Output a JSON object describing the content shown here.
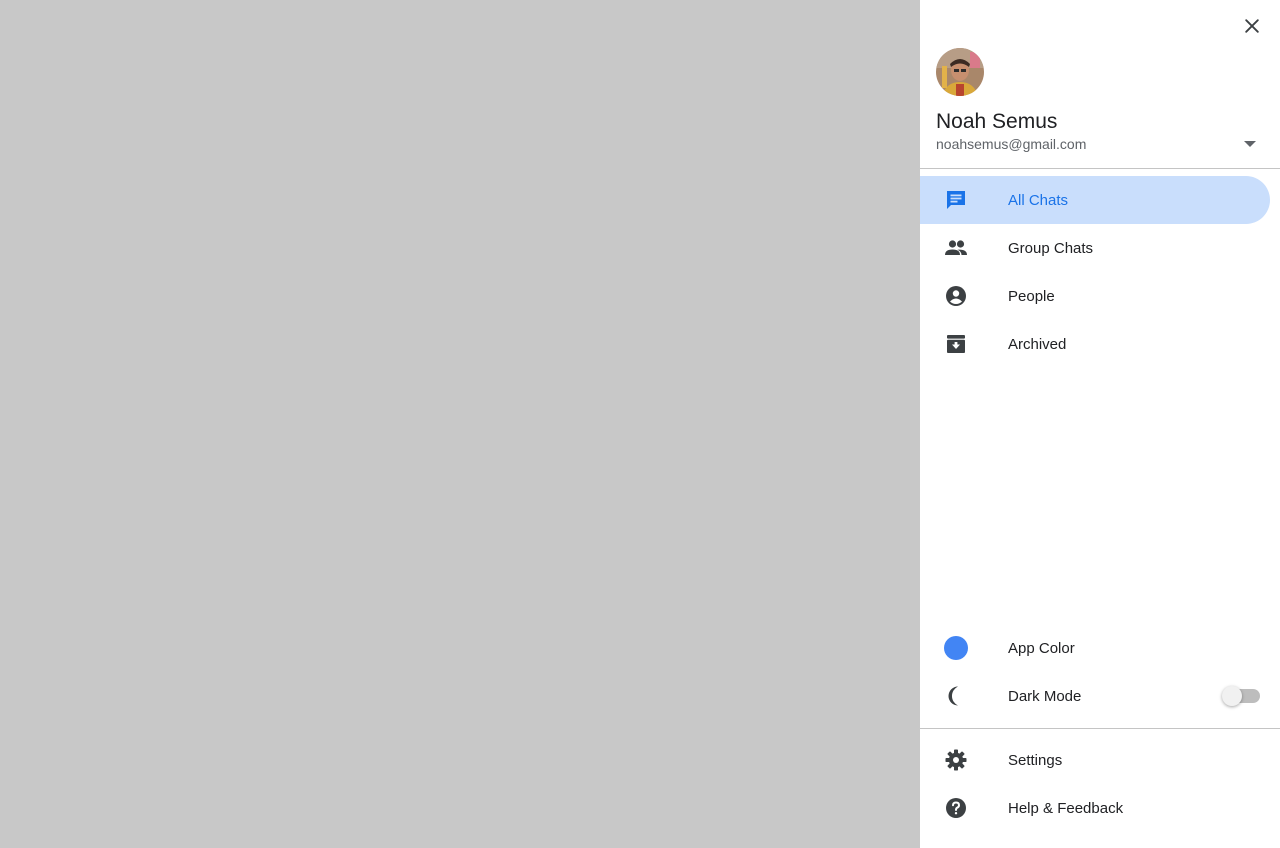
{
  "account": {
    "name": "Noah Semus",
    "email": "noahsemus@gmail.com"
  },
  "nav": {
    "items": [
      {
        "label": "All Chats",
        "icon": "chat-icon",
        "active": true
      },
      {
        "label": "Group Chats",
        "icon": "group-icon",
        "active": false
      },
      {
        "label": "People",
        "icon": "person-icon",
        "active": false
      },
      {
        "label": "Archived",
        "icon": "archive-icon",
        "active": false
      }
    ]
  },
  "preferences": {
    "app_color_label": "App Color",
    "app_color_value": "#4285f4",
    "dark_mode_label": "Dark Mode",
    "dark_mode_enabled": false
  },
  "footer": {
    "settings_label": "Settings",
    "help_label": "Help & Feedback"
  },
  "colors": {
    "accent": "#1a73e8",
    "active_bg": "#c9defc",
    "scrim": "#c8c8c8"
  }
}
